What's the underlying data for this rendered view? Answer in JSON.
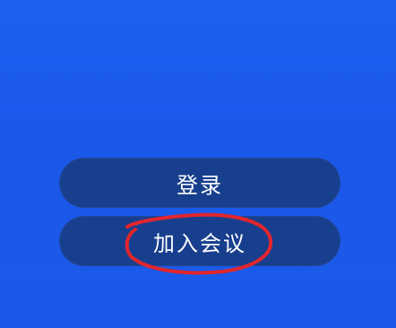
{
  "buttons": {
    "login_label": "登录",
    "join_meeting_label": "加入会议"
  },
  "colors": {
    "background": "#1e5ff0",
    "button_fill": "#183f8e",
    "button_text": "#ffffff",
    "annotation_stroke": "#e1262d"
  }
}
